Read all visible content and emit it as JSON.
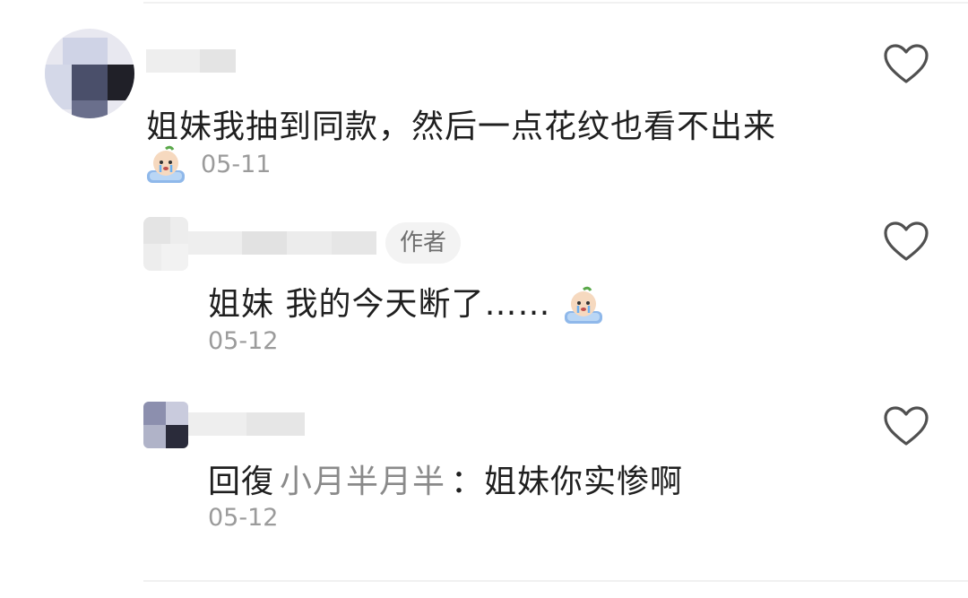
{
  "comments": [
    {
      "text": "姐妹我抽到同款，然后一点花纹也看不出来",
      "date": "05-11",
      "emoji": "crying-baby-emoji",
      "like_icon": "heart-outline-icon"
    },
    {
      "author_badge": "作者",
      "text": "姐妹 我的今天断了……",
      "emoji": "crying-baby-emoji",
      "date": "05-12",
      "like_icon": "heart-outline-icon"
    },
    {
      "reply_label": "回復",
      "reply_target": "小月半月半",
      "text_suffix": "：姐妹你实惨啊",
      "date": "05-12",
      "like_icon": "heart-outline-icon"
    }
  ],
  "colors": {
    "text": "#1f1f1f",
    "muted": "#9b9b9b",
    "badge_bg": "#f3f3f3",
    "heart": "#505050"
  }
}
